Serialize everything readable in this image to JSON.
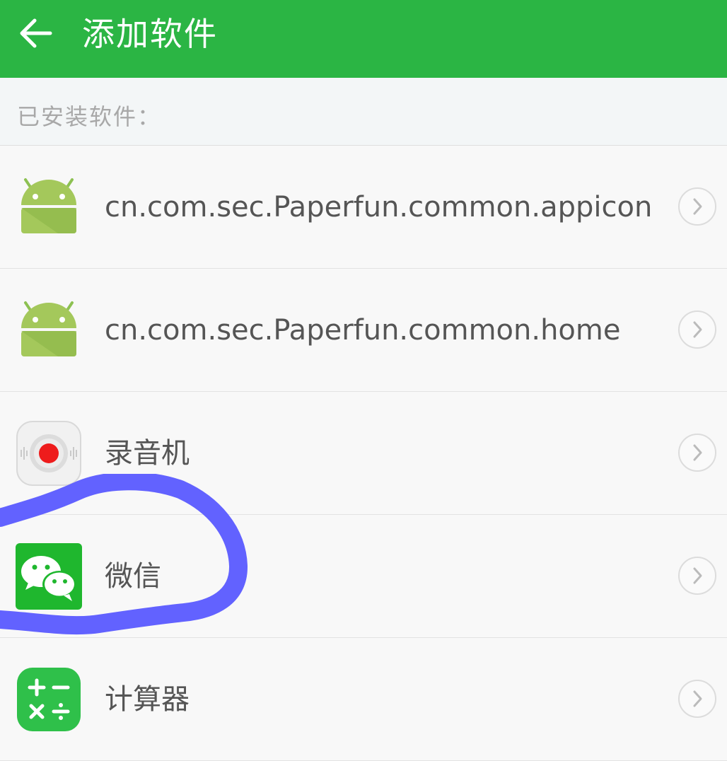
{
  "header": {
    "back_icon": "arrow-left-icon",
    "title": "添加软件"
  },
  "section": {
    "label": "已安装软件："
  },
  "apps": [
    {
      "name": "cn.com.sec.Paperfun.common.appicon",
      "icon": "android-icon"
    },
    {
      "name": "cn.com.sec.Paperfun.common.home",
      "icon": "android-icon"
    },
    {
      "name": "录音机",
      "icon": "recorder-icon"
    },
    {
      "name": "微信",
      "icon": "wechat-icon"
    },
    {
      "name": "计算器",
      "icon": "calculator-icon"
    }
  ],
  "colors": {
    "appbar": "#2bb544",
    "annotation": "#6262ff",
    "text": "#555555",
    "section_text": "#a8a8a8"
  }
}
